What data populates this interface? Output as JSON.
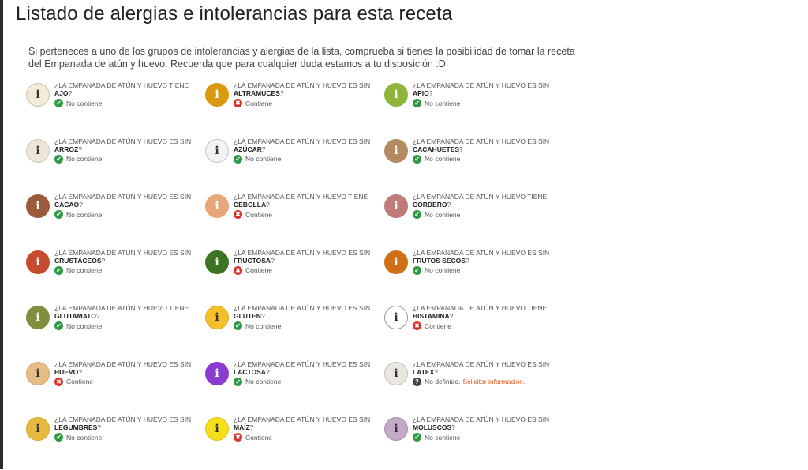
{
  "page": {
    "title": "Listado de alergias e intolerancias para esta receta",
    "intro": "Si perteneces a uno de los grupos de intolerancias y alergias de la lista, comprueba si tienes la posibilidad de tomar la receta del Empanada de atún y huevo. Recuerda que para cualquier duda estamos a tu disposición :D"
  },
  "badge_letter": "i",
  "status_labels": {
    "ok": "No contiene",
    "no": "Contiene",
    "undef": "No definido."
  },
  "request_link": "Solicitar información.",
  "items": [
    {
      "prefix": "¿La empanada de atún y huevo tiene",
      "name": "ajo",
      "status": "ok",
      "color": "#f1ecd8",
      "text_color": "#333",
      "border": "#c9c2a6"
    },
    {
      "prefix": "¿La empanada de atún y huevo es sin",
      "name": "altramuces",
      "status": "no",
      "color": "#d99a10",
      "text_color": "#ffffff",
      "border": "#d99a10"
    },
    {
      "prefix": "¿La empanada de atún y huevo es sin",
      "name": "apio",
      "status": "ok",
      "color": "#8fb63a",
      "text_color": "#ffffff",
      "border": "#8fb63a"
    },
    {
      "prefix": "¿La empanada de atún y huevo es sin",
      "name": "arroz",
      "status": "ok",
      "color": "#ece6d8",
      "text_color": "#333",
      "border": "#cfc8b5"
    },
    {
      "prefix": "¿La empanada de atún y huevo es sin",
      "name": "azúcar",
      "status": "ok",
      "color": "#f4f2f5",
      "text_color": "#333",
      "border": "#c8c3cc"
    },
    {
      "prefix": "¿La empanada de atún y huevo es sin",
      "name": "cacahuetes",
      "status": "ok",
      "color": "#b48a60",
      "text_color": "#ffffff",
      "border": "#b48a60"
    },
    {
      "prefix": "¿La empanada de atún y huevo es sin",
      "name": "cacao",
      "status": "ok",
      "color": "#9a5a3c",
      "text_color": "#ffffff",
      "border": "#9a5a3c"
    },
    {
      "prefix": "¿La empanada de atún y huevo tiene",
      "name": "cebolla",
      "status": "no",
      "color": "#e8a77a",
      "text_color": "#ffffff",
      "border": "#e8a77a"
    },
    {
      "prefix": "¿La empanada de atún y huevo tiene",
      "name": "cordero",
      "status": "ok",
      "color": "#c07a78",
      "text_color": "#ffffff",
      "border": "#c07a78"
    },
    {
      "prefix": "¿La empanada de atún y huevo es sin",
      "name": "crustáceos",
      "status": "ok",
      "color": "#c74a2f",
      "text_color": "#ffffff",
      "border": "#c74a2f"
    },
    {
      "prefix": "¿La empanada de atún y huevo es sin",
      "name": "fructosa",
      "status": "no",
      "color": "#3d7422",
      "text_color": "#ffffff",
      "border": "#3d7422"
    },
    {
      "prefix": "¿La empanada de atún y huevo es sin",
      "name": "frutos secos",
      "status": "ok",
      "color": "#d06f18",
      "text_color": "#ffffff",
      "border": "#d06f18"
    },
    {
      "prefix": "¿La empanada de atún y huevo tiene",
      "name": "glutamato",
      "status": "ok",
      "color": "#7f8f3e",
      "text_color": "#ffffff",
      "border": "#7f8f3e"
    },
    {
      "prefix": "¿La empanada de atún y huevo es sin",
      "name": "gluten",
      "status": "ok",
      "color": "#f4bf2a",
      "text_color": "#333",
      "border": "#e0ab1a"
    },
    {
      "prefix": "¿La empanada de atún y huevo tiene",
      "name": "histamina",
      "status": "no",
      "color": "#ffffff",
      "text_color": "#333",
      "border": "#999999"
    },
    {
      "prefix": "¿La empanada de atún y huevo es sin",
      "name": "huevo",
      "status": "no",
      "color": "#e7bc86",
      "text_color": "#333",
      "border": "#d4a46e"
    },
    {
      "prefix": "¿La empanada de atún y huevo es sin",
      "name": "lactosa",
      "status": "ok",
      "color": "#8a3bd0",
      "text_color": "#ffffff",
      "border": "#8a3bd0"
    },
    {
      "prefix": "¿La empanada de atún y huevo es sin",
      "name": "latex",
      "status": "undef",
      "color": "#e9e6e0",
      "text_color": "#333",
      "border": "#c4c0b8"
    },
    {
      "prefix": "¿La empanada de atún y huevo es sin",
      "name": "legumbres",
      "status": "ok",
      "color": "#e8ba3f",
      "text_color": "#333",
      "border": "#d4a428"
    },
    {
      "prefix": "¿La empanada de atún y huevo es sin",
      "name": "maíz",
      "status": "no",
      "color": "#f5df1c",
      "text_color": "#333",
      "border": "#dcc410"
    },
    {
      "prefix": "¿La empanada de atún y huevo es sin",
      "name": "moluscos",
      "status": "ok",
      "color": "#c4a9c8",
      "text_color": "#333",
      "border": "#ab8fb0"
    }
  ]
}
